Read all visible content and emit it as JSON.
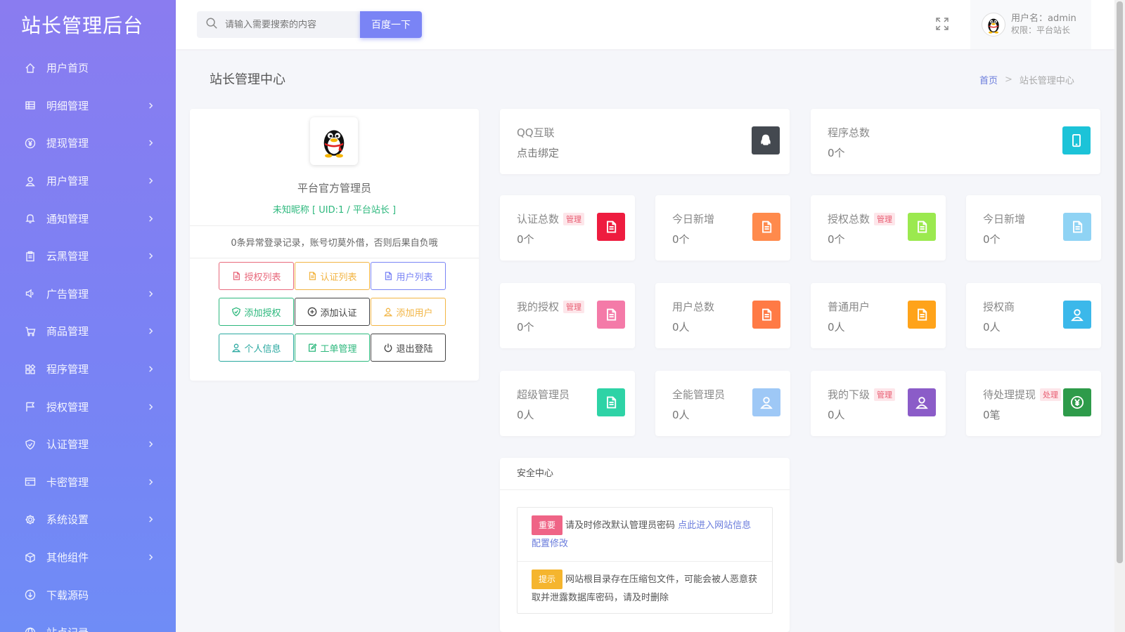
{
  "sidebar": {
    "brand": "站长管理后台",
    "items": [
      {
        "label": "用户首页",
        "icon": "home-icon",
        "has_children": false
      },
      {
        "label": "明细管理",
        "icon": "list-icon",
        "has_children": true
      },
      {
        "label": "提现管理",
        "icon": "yen-icon",
        "has_children": true
      },
      {
        "label": "用户管理",
        "icon": "user-icon",
        "has_children": true
      },
      {
        "label": "通知管理",
        "icon": "bell-icon",
        "has_children": true
      },
      {
        "label": "云黑管理",
        "icon": "clipboard-icon",
        "has_children": true
      },
      {
        "label": "广告管理",
        "icon": "speaker-icon",
        "has_children": true
      },
      {
        "label": "商品管理",
        "icon": "cart-icon",
        "has_children": true
      },
      {
        "label": "程序管理",
        "icon": "apps-icon",
        "has_children": true
      },
      {
        "label": "授权管理",
        "icon": "flag-icon",
        "has_children": true
      },
      {
        "label": "认证管理",
        "icon": "shield-icon",
        "has_children": true
      },
      {
        "label": "卡密管理",
        "icon": "card-icon",
        "has_children": true
      },
      {
        "label": "系统设置",
        "icon": "gear-icon",
        "has_children": true
      },
      {
        "label": "其他组件",
        "icon": "cube-icon",
        "has_children": true
      },
      {
        "label": "下载源码",
        "icon": "download-icon",
        "has_children": false
      },
      {
        "label": "站点记录",
        "icon": "globe-icon",
        "has_children": false
      }
    ]
  },
  "header": {
    "search_placeholder": "请输入需要搜索的内容",
    "search_button": "百度一下",
    "username": "用户名：admin",
    "role": "权限：平台站长"
  },
  "page": {
    "title": "站长管理中心",
    "breadcrumb_home": "首页",
    "breadcrumb_sep": ">",
    "breadcrumb_current": "站长管理中心"
  },
  "profile": {
    "name": "平台官方管理员",
    "nickname": "未知昵称 [ UID:1 / 平台站长 ]",
    "notice": "0条异常登录记录，账号切莫外借，否则后果自负哦",
    "buttons": [
      {
        "label": "授权列表",
        "icon": "document-icon",
        "color": "#e8697c"
      },
      {
        "label": "认证列表",
        "icon": "document-icon",
        "color": "#f2b544"
      },
      {
        "label": "用户列表",
        "icon": "document-icon",
        "color": "#7a84f5"
      },
      {
        "label": "添加授权",
        "icon": "shield-check-icon",
        "color": "#2db87d"
      },
      {
        "label": "添加认证",
        "icon": "plus-circle-icon",
        "color": "#444444"
      },
      {
        "label": "添加用户",
        "icon": "user-icon",
        "color": "#f2b544"
      },
      {
        "label": "个人信息",
        "icon": "user-icon",
        "color": "#2aa8a0"
      },
      {
        "label": "工单管理",
        "icon": "edit-icon",
        "color": "#2db87d"
      },
      {
        "label": "退出登陆",
        "icon": "power-icon",
        "color": "#444444"
      }
    ]
  },
  "stats": [
    {
      "label": "QQ互联",
      "value": "点击绑定",
      "badge": "",
      "icon": "qq-icon",
      "color": "#444950"
    },
    {
      "label": "程序总数",
      "value": "0个",
      "badge": "",
      "icon": "tablet-icon",
      "color": "#1cc3d8"
    },
    {
      "label": "认证总数",
      "value": "0个",
      "badge": "管理",
      "icon": "document-icon",
      "color": "#ee1c3f"
    },
    {
      "label": "今日新增",
      "value": "0个",
      "badge": "",
      "icon": "document-icon",
      "color": "#ff8a4c"
    },
    {
      "label": "授权总数",
      "value": "0个",
      "badge": "管理",
      "icon": "document-icon",
      "color": "#9be94f"
    },
    {
      "label": "今日新增",
      "value": "0个",
      "badge": "",
      "icon": "document-icon",
      "color": "#8fd3f4"
    },
    {
      "label": "我的授权",
      "value": "0个",
      "badge": "管理",
      "icon": "document-icon",
      "color": "#f47aa8"
    },
    {
      "label": "用户总数",
      "value": "0人",
      "badge": "",
      "icon": "document-icon",
      "color": "#ff7a45"
    },
    {
      "label": "普通用户",
      "value": "0人",
      "badge": "",
      "icon": "document-icon",
      "color": "#ffa31a"
    },
    {
      "label": "授权商",
      "value": "0人",
      "badge": "",
      "icon": "user-icon",
      "color": "#3bb8ea"
    },
    {
      "label": "超级管理员",
      "value": "0人",
      "badge": "",
      "icon": "document-icon",
      "color": "#2ed3a6"
    },
    {
      "label": "全能管理员",
      "value": "0人",
      "badge": "",
      "icon": "user-icon",
      "color": "#9ec8f6"
    },
    {
      "label": "我的下级",
      "value": "0人",
      "badge": "管理",
      "icon": "user-icon",
      "color": "#8b5cc8"
    },
    {
      "label": "待处理提现",
      "value": "0笔",
      "badge": "处理",
      "icon": "yen-icon",
      "color": "#2e9b4a"
    }
  ],
  "security": {
    "title": "安全中心",
    "items": [
      {
        "tag": "重要",
        "tag_color": "#ef6486",
        "text": "请及时修改默认管理员密码 ",
        "link": "点此进入网站信息配置修改"
      },
      {
        "tag": "提示",
        "tag_color": "#f5b52e",
        "text": "网站根目录存在压缩包文件，可能会被人恶意获取并泄露数据库密码，请及时删除",
        "link": ""
      }
    ]
  }
}
